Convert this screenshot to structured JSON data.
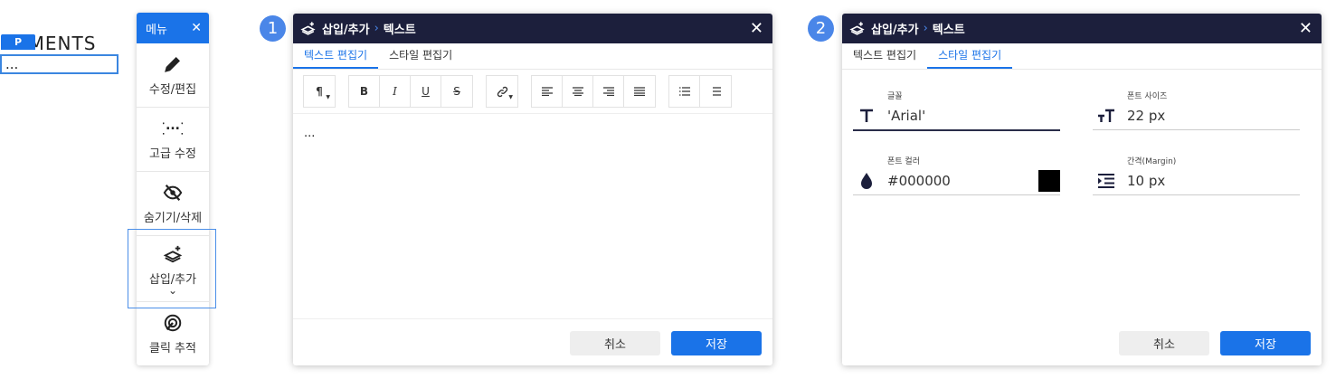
{
  "page_fragment": {
    "elements_text": "EMENTS",
    "badge": "P",
    "selected_text": "..."
  },
  "menu": {
    "title": "메뉴",
    "close": "✕",
    "items": [
      {
        "label": "수정/편집",
        "icon": "pencil-icon"
      },
      {
        "label": "고급 수정",
        "icon": "code-braces-icon"
      },
      {
        "label": "숨기기/삭제",
        "icon": "eye-off-icon"
      },
      {
        "label": "삽입/추가",
        "icon": "layers-plus-icon",
        "chevron": "⌄"
      },
      {
        "label": "클릭 추적",
        "icon": "target-icon"
      }
    ]
  },
  "steps": [
    "1",
    "2"
  ],
  "dialog1": {
    "crumb_parent": "삽입/추가",
    "crumb_sep": "›",
    "crumb_current": "텍스트",
    "close": "✕",
    "tabs": [
      "텍스트 편집기",
      "스타일 편집기"
    ],
    "toolbar": {
      "paragraph": "¶",
      "bold": "B",
      "italic": "I",
      "underline": "U",
      "strike": "S"
    },
    "content": "...",
    "cancel": "취소",
    "save": "저장"
  },
  "dialog2": {
    "crumb_parent": "삽입/추가",
    "crumb_sep": "›",
    "crumb_current": "텍스트",
    "close": "✕",
    "tabs": [
      "텍스트 편집기",
      "스타일 편집기"
    ],
    "fields": {
      "font": {
        "label": "글꼴",
        "value": "'Arial'"
      },
      "font_size": {
        "label": "폰트 사이즈",
        "value": "22 px"
      },
      "font_color": {
        "label": "폰트 컬러",
        "value": "#000000",
        "swatch": "#000000"
      },
      "margin": {
        "label": "간격(Margin)",
        "value": "10 px"
      }
    },
    "cancel": "취소",
    "save": "저장"
  },
  "colors": {
    "accent": "#1a73e8",
    "header_dark": "#1c1f3c",
    "step_circle": "#4a86e8"
  }
}
